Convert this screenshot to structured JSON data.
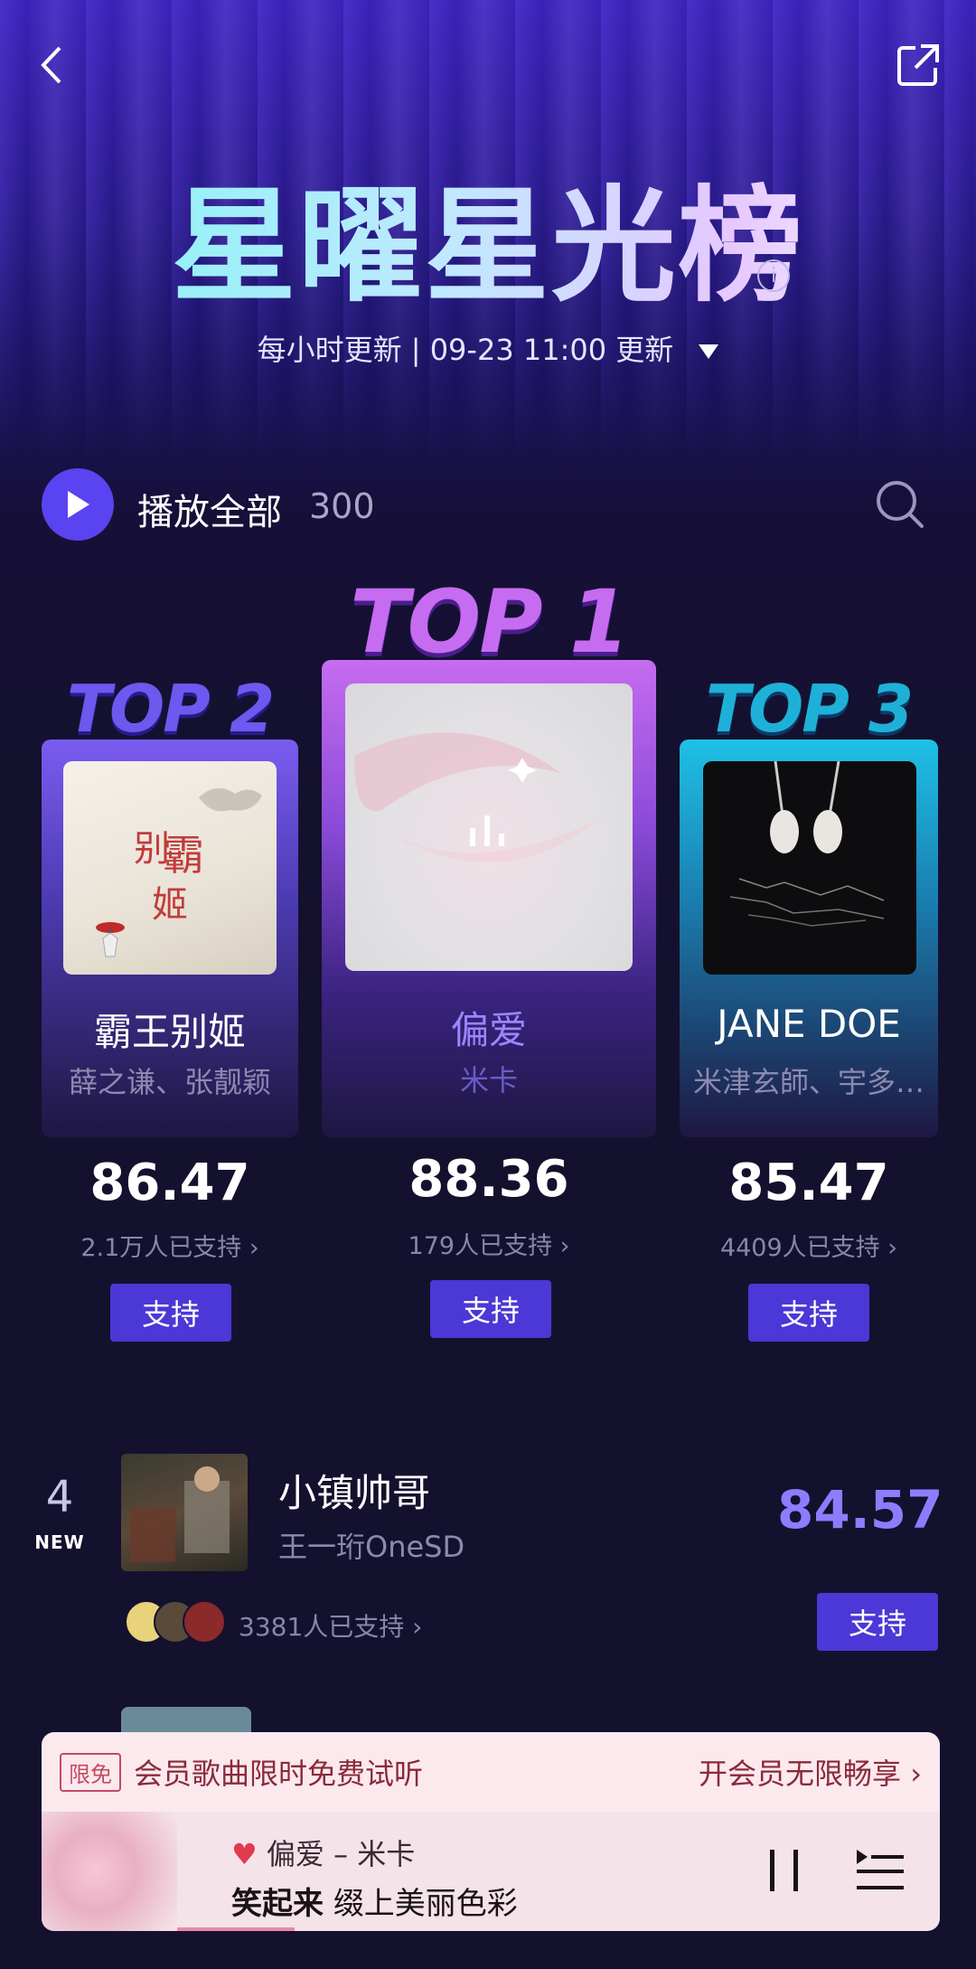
{
  "header": {
    "title": "星曜星光榜",
    "update_text": "每小时更新 | 09-23 11:00 更新",
    "back_icon": "chevron-left-icon",
    "share_icon": "share-icon",
    "info_icon": "i"
  },
  "play_all": {
    "label": "播放全部",
    "count": "300"
  },
  "podium": [
    {
      "rank_label": "TOP 2",
      "song": "霸王别姬",
      "artist": "薛之谦、张靓颖",
      "score": "86.47",
      "supporters": "2.1万人已支持 ›",
      "button": "支持"
    },
    {
      "rank_label": "TOP 1",
      "song": "偏爱",
      "artist": "米卡",
      "score": "88.36",
      "supporters": "179人已支持 ›",
      "button": "支持"
    },
    {
      "rank_label": "TOP 3",
      "song": "JANE DOE",
      "artist": "米津玄師、宇多…",
      "score": "85.47",
      "supporters": "4409人已支持 ›",
      "button": "支持"
    }
  ],
  "list": [
    {
      "rank": "4",
      "badge": "NEW",
      "song": "小镇帅哥",
      "artist": "王一珩OneSD",
      "score": "84.57",
      "supporters": "3381人已支持 ›",
      "button": "支持"
    }
  ],
  "promo": {
    "tag": "限免",
    "text": "会员歌曲限时免费试听",
    "link": "开会员无限畅享 ›"
  },
  "player": {
    "now_playing": "偏爱 – 米卡",
    "lyric_bold": "笑起来",
    "lyric_rest": "缀上美丽色彩"
  },
  "colors": {
    "accent": "#4b38d6",
    "top1": "#c66cf0",
    "top2": "#7a5cf0",
    "top3": "#1fc0e6"
  }
}
